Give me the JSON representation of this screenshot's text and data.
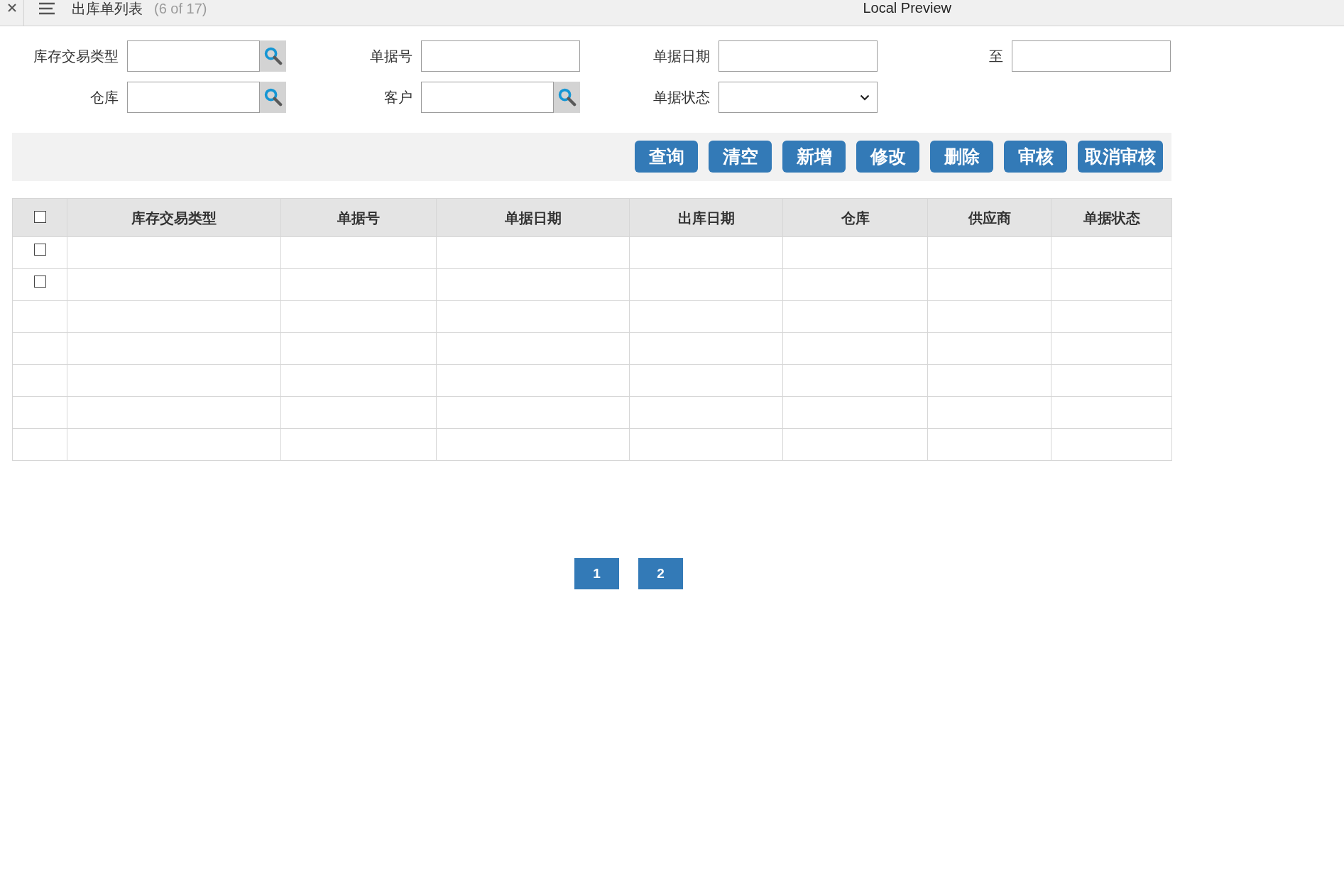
{
  "top_bar": {
    "title": "出库单列表",
    "position": "(6 of 17)",
    "preview_label": "Local Preview"
  },
  "filters": [
    {
      "label": "库存交易类型",
      "kind": "lookup"
    },
    {
      "label": "单据号",
      "kind": "text"
    },
    {
      "label": "单据日期",
      "kind": "text"
    },
    {
      "label": "至",
      "kind": "text"
    },
    {
      "label": "仓库",
      "kind": "lookup"
    },
    {
      "label": "客户",
      "kind": "lookup"
    },
    {
      "label": "单据状态",
      "kind": "select"
    }
  ],
  "toolbar": {
    "buttons": [
      "查询",
      "清空",
      "新增",
      "修改",
      "删除",
      "审核",
      "取消审核"
    ]
  },
  "table": {
    "select_all": {
      "checked": false
    },
    "columns": [
      "库存交易类型",
      "单据号",
      "单据日期",
      "出库日期",
      "仓库",
      "供应商",
      "单据状态"
    ],
    "rows": [
      {
        "kind": "record",
        "checked": false
      },
      {
        "kind": "record",
        "checked": false
      },
      {
        "kind": "blank"
      },
      {
        "kind": "blank"
      },
      {
        "kind": "blank"
      },
      {
        "kind": "blank"
      },
      {
        "kind": "blank"
      }
    ]
  },
  "pagination": {
    "pages": [
      "1",
      "2"
    ]
  }
}
